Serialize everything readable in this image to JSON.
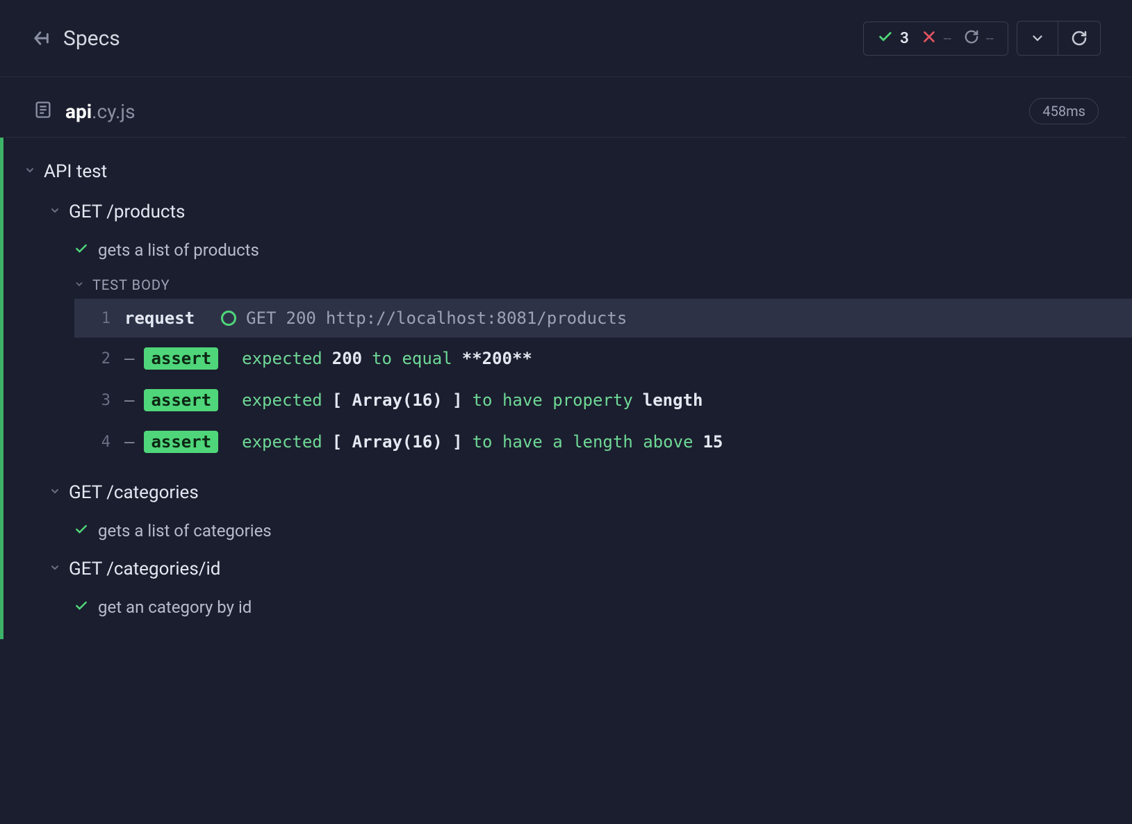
{
  "header": {
    "title": "Specs",
    "stats": {
      "passed": "3",
      "failed": "--",
      "pending": "--"
    }
  },
  "file": {
    "name": "api",
    "ext": ".cy.js",
    "duration": "458ms"
  },
  "suite": {
    "title": "API test",
    "groups": [
      {
        "title": "GET /products",
        "tests": [
          {
            "title": "gets a list of products",
            "bodyLabel": "TEST BODY",
            "commands": [
              {
                "num": "1",
                "type": "request",
                "highlighted": true,
                "method": "GET",
                "status": "200",
                "url": "http://localhost:8081/products"
              },
              {
                "num": "2",
                "type": "assert",
                "parts": [
                  "expected",
                  " ",
                  "200",
                  " ",
                  "to equal",
                  " ",
                  "**200**"
                ]
              },
              {
                "num": "3",
                "type": "assert",
                "parts": [
                  "expected",
                  " ",
                  "[ Array(16) ]",
                  " ",
                  "to have property",
                  " ",
                  "length"
                ]
              },
              {
                "num": "4",
                "type": "assert",
                "parts": [
                  "expected",
                  " ",
                  "[ Array(16) ]",
                  " ",
                  "to have a length above",
                  " ",
                  "15"
                ]
              }
            ]
          }
        ]
      },
      {
        "title": "GET /categories",
        "tests": [
          {
            "title": "gets a list of categories"
          }
        ]
      },
      {
        "title": "GET /categories/id",
        "tests": [
          {
            "title": "get an category by id"
          }
        ]
      }
    ]
  }
}
